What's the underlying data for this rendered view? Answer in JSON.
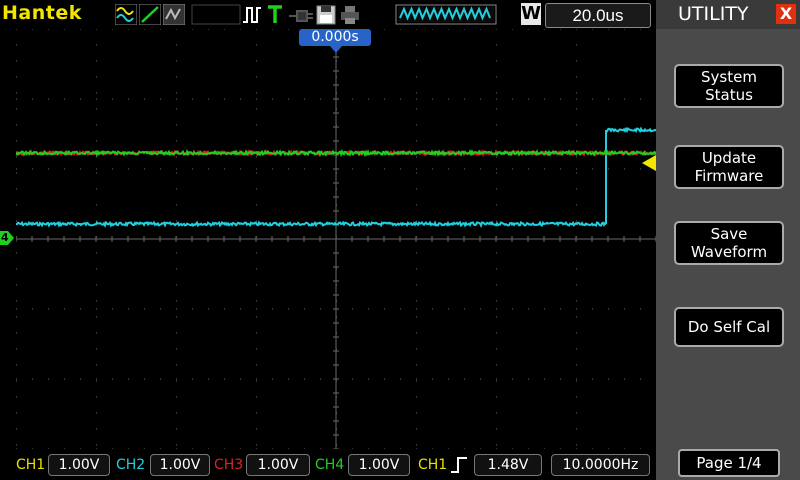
{
  "topbar": {
    "brand": "Hantek",
    "timebase_mode": "W",
    "timebase": "20.0us",
    "icons": [
      "waveform-math-icon",
      "slope-icon",
      "trace-icon",
      "run-stop-icon",
      "trigger-T-icon",
      "probe-icon",
      "save-disk-icon",
      "printer-icon",
      "memory-depth-icon"
    ]
  },
  "plot": {
    "trigger_time": "0.000s",
    "ch4_marker": "4",
    "colors": {
      "grid": "#6a6a6a",
      "ch1": "#e8e000",
      "ch2": "#20d0e0",
      "ch3": "#e02020",
      "ch4": "#20d020",
      "trigger": "#f2e600"
    }
  },
  "menu": {
    "title": "UTILITY",
    "close": "X",
    "buttons": [
      {
        "line1": "System",
        "line2": "Status"
      },
      {
        "line1": "Update",
        "line2": "Firmware"
      },
      {
        "line1": "Save",
        "line2": "Waveform"
      },
      {
        "line1": "Do Self Cal",
        "line2": ""
      }
    ],
    "page": "Page 1/4"
  },
  "status": {
    "ch1": {
      "label": "CH1",
      "value": "1.00V"
    },
    "ch2": {
      "label": "CH2",
      "value": "1.00V"
    },
    "ch3": {
      "label": "CH3",
      "value": "1.00V"
    },
    "ch4": {
      "label": "CH4",
      "value": "1.00V"
    },
    "trigger": {
      "source": "CH1",
      "level": "1.48V",
      "frequency": "10.0000Hz"
    }
  }
}
